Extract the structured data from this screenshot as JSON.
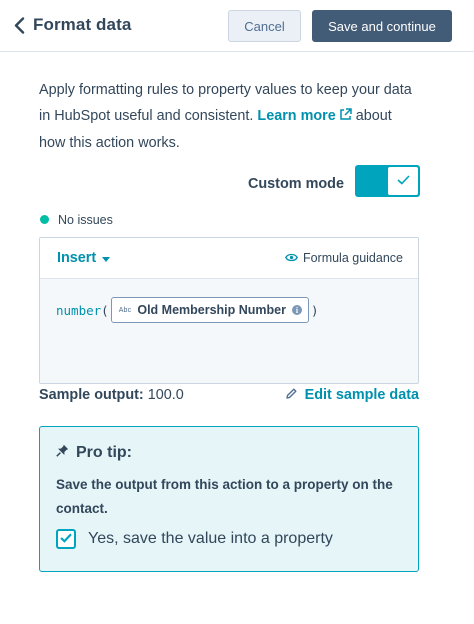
{
  "header": {
    "title": "Format data",
    "cancel_label": "Cancel",
    "save_label": "Save and continue"
  },
  "intro": {
    "text_before": "Apply formatting rules to property values to keep your data in HubSpot useful and consistent. ",
    "learn_more": "Learn more",
    "text_after": " about how this action works."
  },
  "custom_mode": {
    "label": "Custom mode",
    "enabled": true
  },
  "status": {
    "text": "No issues",
    "color": "#00bda5"
  },
  "editor": {
    "insert_label": "Insert",
    "formula_guidance_label": "Formula guidance",
    "function_name": "number",
    "open_paren": "(",
    "close_paren": ")",
    "token_type": "Abc",
    "token_name": "Old Membership Number",
    "token_info": "i"
  },
  "sample": {
    "label": "Sample output:",
    "value": "100.0",
    "edit_label": "Edit sample data"
  },
  "tip": {
    "title": "Pro tip:",
    "text": "Save the output from this action to a property on the contact.",
    "checkbox_label": "Yes, save the value into a property",
    "checked": true
  },
  "colors": {
    "accent": "#00a4bd",
    "link": "#0091ae",
    "primary_button": "#425b76",
    "text": "#33475b"
  }
}
